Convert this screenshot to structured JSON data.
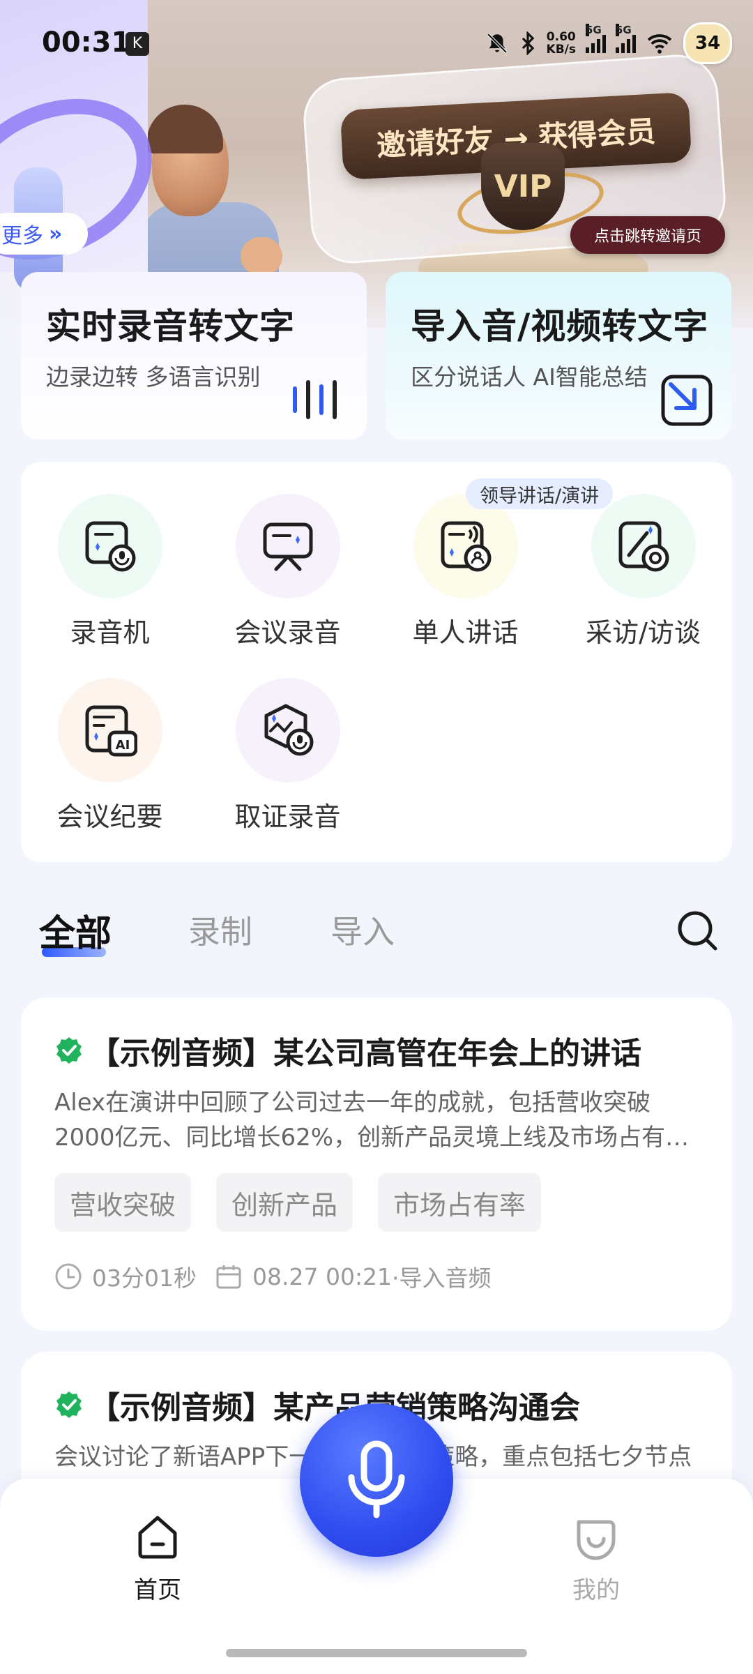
{
  "status_bar": {
    "time": "00:31",
    "app_badge": "K",
    "net_speed_value": "0.60",
    "net_speed_unit": "KB/s",
    "signal_1_label": "5G",
    "signal_2_label": "5G",
    "battery": "34"
  },
  "banner": {
    "invite_text": "邀请好友 → 获得会员",
    "vip_text": "VIP",
    "jump_label": "点击跳转邀请页",
    "more_label": "更多"
  },
  "quick_cards": [
    {
      "title": "实时录音转文字",
      "subtitle": "边录边转 多语言识别",
      "icon": "waveform-icon"
    },
    {
      "title": "导入音/视频转文字",
      "subtitle": "区分说话人 AI智能总结",
      "icon": "import-arrow-icon"
    }
  ],
  "features": [
    {
      "label": "录音机",
      "icon": "recorder-icon",
      "bg": "#eefbf4"
    },
    {
      "label": "会议录音",
      "icon": "meeting-board-icon",
      "bg": "#f7f1fb"
    },
    {
      "label": "单人讲话",
      "icon": "speaker-icon",
      "bg": "#fdfbea",
      "badge": "领导讲话/演讲"
    },
    {
      "label": "采访/访谈",
      "icon": "interview-icon",
      "bg": "#eefbf4"
    },
    {
      "label": "会议纪要",
      "icon": "ai-minutes-icon",
      "bg": "#fdf4ee"
    },
    {
      "label": "取证录音",
      "icon": "evidence-icon",
      "bg": "#f7f1fb"
    }
  ],
  "tabs": [
    {
      "label": "全部",
      "active": true
    },
    {
      "label": "录制",
      "active": false
    },
    {
      "label": "导入",
      "active": false
    }
  ],
  "recordings": [
    {
      "title": "【示例音频】某公司高管在年会上的讲话",
      "summary": "Alex在演讲中回顾了公司过去一年的成就，包括营收突破2000亿元、同比增长62%，创新产品灵境上线及市场占有率提升等内容。",
      "tags": [
        "营收突破",
        "创新产品",
        "市场占有率"
      ],
      "duration": "03分01秒",
      "date": "08.27 00:21",
      "source": "·导入音频"
    },
    {
      "title": "【示例音频】某产品营销策略沟通会",
      "summary": "会议讨论了新语APP下一阶段的营销策略，重点包括七夕节点",
      "tags": [],
      "duration": "",
      "date": "",
      "source": ""
    }
  ],
  "bottom_nav": {
    "home_label": "首页",
    "profile_label": "我的",
    "accent": "#2f4df0"
  }
}
